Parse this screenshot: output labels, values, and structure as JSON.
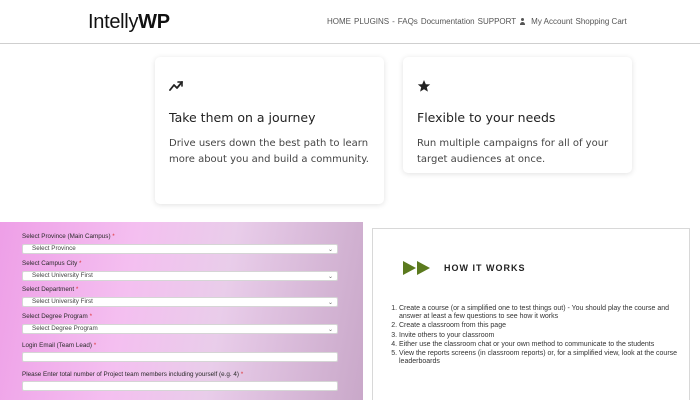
{
  "header": {
    "logo_text": "Intelly",
    "logo_bold": "WP",
    "nav": [
      "HOME",
      "PLUGINS",
      "FAQs",
      "Documentation",
      "SUPPORT",
      "My Account",
      "Shopping Cart"
    ],
    "nav_separator": "-"
  },
  "features": [
    {
      "icon": "trending-up-icon",
      "title": "Take them on a journey",
      "description": "Drive users down the best path to learn more about you and build a community."
    },
    {
      "icon": "star-icon",
      "title": "Flexible to your needs",
      "description": "Run multiple campaigns for all of your target audiences at once."
    }
  ],
  "form": {
    "province_label": "Select Province (Main Campus)",
    "province_value": "Select Province",
    "city_label": "Select Campus City",
    "city_value": "Select University First",
    "department_label": "Select Department",
    "department_value": "Select University First",
    "program_label": "Select Degree Program",
    "program_value": "Select Degree Program",
    "email_label": "Login Email (Team Lead)",
    "members_label": "Please Enter total number of Project team members including yourself (e.g. 4)",
    "required_mark": "*"
  },
  "how_it_works": {
    "heading": "HOW IT WORKS",
    "steps": [
      "Create a course (or a simplified one to test things out) - You should play the course and answer at least a few questions to see how it works",
      "Create a classroom from this page",
      "Invite others to your classroom",
      "Either use the classroom chat or your own method to communicate to the students",
      "View the reports screens (in classroom reports) or, for a simplified view, look at the course leaderboards"
    ]
  },
  "colors": {
    "accent_green": "#5b7a1e",
    "form_gradient_start": "#ee9fe7",
    "form_gradient_end": "#c9a8c9"
  }
}
